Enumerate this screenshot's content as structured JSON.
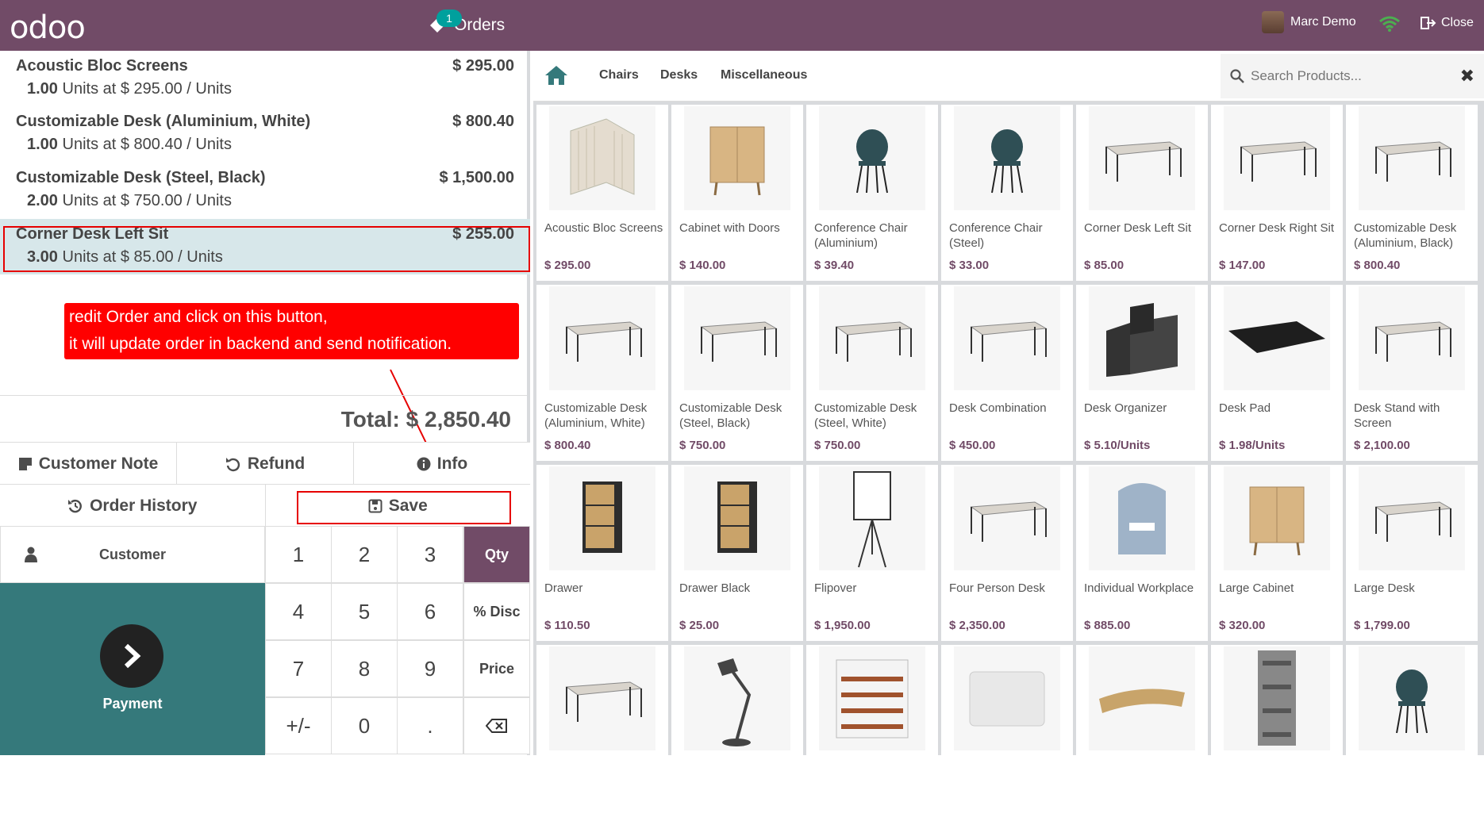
{
  "header": {
    "logo": "odoo",
    "orders_label": "Orders",
    "orders_badge": "1",
    "user_name": "Marc Demo",
    "close_label": "Close"
  },
  "order_lines": [
    {
      "name": "Acoustic Bloc Screens",
      "price": "$ 295.00",
      "qty": "1.00",
      "unit_text": "Units at $ 295.00 / Units"
    },
    {
      "name": "Customizable Desk (Aluminium, White)",
      "price": "$ 800.40",
      "qty": "1.00",
      "unit_text": "Units at $ 800.40 / Units"
    },
    {
      "name": "Customizable Desk (Steel, Black)",
      "price": "$ 1,500.00",
      "qty": "2.00",
      "unit_text": "Units at $ 750.00 / Units"
    },
    {
      "name": "Corner Desk Left Sit",
      "price": "$ 255.00",
      "qty": "3.00",
      "unit_text": "Units at $ 85.00 / Units"
    }
  ],
  "annotation": {
    "line1": "redit Order and click on this button,",
    "line2": "it will update order in backend and send notification."
  },
  "total": "Total: $ 2,850.40",
  "actions": {
    "customer_note": "Customer Note",
    "refund": "Refund",
    "info": "Info",
    "order_history": "Order History",
    "save": "Save"
  },
  "pad": {
    "customer": "Customer",
    "payment": "Payment",
    "keys": [
      "1",
      "2",
      "3",
      "4",
      "5",
      "6",
      "7",
      "8",
      "9",
      "+/-",
      "0",
      "."
    ],
    "modes": [
      "Qty",
      "% Disc",
      "Price"
    ]
  },
  "categories": [
    "Chairs",
    "Desks",
    "Miscellaneous"
  ],
  "search": {
    "placeholder": "Search Products..."
  },
  "products": [
    {
      "name": "Acoustic Bloc Screens",
      "price": "$ 295.00",
      "icon": "screen-icon"
    },
    {
      "name": "Cabinet with Doors",
      "price": "$ 140.00",
      "icon": "cabinet-icon"
    },
    {
      "name": "Conference Chair (Aluminium)",
      "price": "$ 39.40",
      "icon": "chair-icon"
    },
    {
      "name": "Conference Chair (Steel)",
      "price": "$ 33.00",
      "icon": "chair-icon"
    },
    {
      "name": "Corner Desk Left Sit",
      "price": "$ 85.00",
      "icon": "desk-icon"
    },
    {
      "name": "Corner Desk Right Sit",
      "price": "$ 147.00",
      "icon": "desk-icon"
    },
    {
      "name": "Customizable Desk (Aluminium, Black)",
      "price": "$ 800.40",
      "icon": "desk-icon"
    },
    {
      "name": "Customizable Desk (Aluminium, White)",
      "price": "$ 800.40",
      "icon": "desk-icon"
    },
    {
      "name": "Customizable Desk (Steel, Black)",
      "price": "$ 750.00",
      "icon": "desk-icon"
    },
    {
      "name": "Customizable Desk (Steel, White)",
      "price": "$ 750.00",
      "icon": "desk-icon"
    },
    {
      "name": "Desk Combination",
      "price": "$ 450.00",
      "icon": "desk-icon"
    },
    {
      "name": "Desk Organizer",
      "price": "$ 5.10/Units",
      "icon": "organizer-icon"
    },
    {
      "name": "Desk Pad",
      "price": "$ 1.98/Units",
      "icon": "pad-icon"
    },
    {
      "name": "Desk Stand with Screen",
      "price": "$ 2,100.00",
      "icon": "desk-icon"
    },
    {
      "name": "Drawer",
      "price": "$ 110.50",
      "icon": "drawer-icon"
    },
    {
      "name": "Drawer Black",
      "price": "$ 25.00",
      "icon": "drawer-icon"
    },
    {
      "name": "Flipover",
      "price": "$ 1,950.00",
      "icon": "flipover-icon"
    },
    {
      "name": "Four Person Desk",
      "price": "$ 2,350.00",
      "icon": "desk-icon"
    },
    {
      "name": "Individual Workplace",
      "price": "$ 885.00",
      "icon": "workplace-icon"
    },
    {
      "name": "Large Cabinet",
      "price": "$ 320.00",
      "icon": "cabinet-icon"
    },
    {
      "name": "Large Desk",
      "price": "$ 1,799.00",
      "icon": "desk-icon"
    },
    {
      "name": "",
      "price": "",
      "icon": "desk-icon"
    },
    {
      "name": "",
      "price": "",
      "icon": "lamp-icon"
    },
    {
      "name": "",
      "price": "",
      "icon": "shelf-icon"
    },
    {
      "name": "",
      "price": "",
      "icon": "board-icon"
    },
    {
      "name": "",
      "price": "",
      "icon": "stand-icon"
    },
    {
      "name": "",
      "price": "",
      "icon": "rack-icon"
    },
    {
      "name": "",
      "price": "",
      "icon": "chair-icon"
    }
  ],
  "colors": {
    "brand": "#714b67",
    "teal": "#35797b",
    "annotation": "#ff0000"
  }
}
